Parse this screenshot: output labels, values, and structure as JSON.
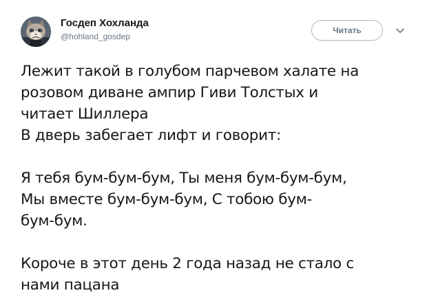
{
  "author": {
    "name": "Госдеп Хохланда",
    "handle": "@hohland_gosdep"
  },
  "actions": {
    "follow_label": "Читать"
  },
  "tweet": {
    "lines": [
      "Лежит такой в голубом парчевом халате на",
      "розовом диване ампир Гиви Толстых и",
      "читает Шиллера",
      "В дверь забегает лифт и говорит:",
      "",
      "Я тебя бум-бум-бум, Ты меня бум-бум-бум,",
      "Мы вместе бум-бум-бум, С тобою бум-",
      "бум-бум.",
      "",
      "Короче в этот день 2 года назад не стало с",
      "нами пацана"
    ]
  },
  "icons": {
    "avatar": "grumpy-cat-avatar",
    "caret": "chevron-down-icon"
  },
  "colors": {
    "text": "#14171a",
    "secondary": "#657786",
    "button_border": "#aab8c2"
  }
}
